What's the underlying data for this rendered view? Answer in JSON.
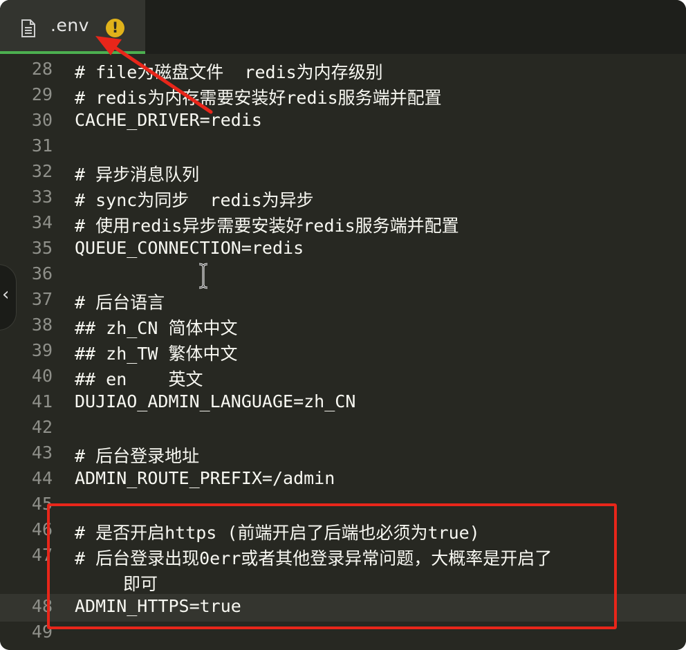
{
  "tab": {
    "title": ".env",
    "icon": "file-icon",
    "status_icon": "warning-icon",
    "warning_glyph": "!"
  },
  "editor": {
    "lines": [
      {
        "number": "28",
        "text": "# file为磁盘文件  redis为内存级别"
      },
      {
        "number": "29",
        "text": "# redis为内存需要安装好redis服务端并配置"
      },
      {
        "number": "30",
        "text": "CACHE_DRIVER=redis"
      },
      {
        "number": "31",
        "text": ""
      },
      {
        "number": "32",
        "text": "# 异步消息队列"
      },
      {
        "number": "33",
        "text": "# sync为同步  redis为异步"
      },
      {
        "number": "34",
        "text": "# 使用redis异步需要安装好redis服务端并配置"
      },
      {
        "number": "35",
        "text": "QUEUE_CONNECTION=redis"
      },
      {
        "number": "36",
        "text": ""
      },
      {
        "number": "37",
        "text": "# 后台语言"
      },
      {
        "number": "38",
        "text": "## zh_CN 简体中文"
      },
      {
        "number": "39",
        "text": "## zh_TW 繁体中文"
      },
      {
        "number": "40",
        "text": "## en    英文"
      },
      {
        "number": "41",
        "text": "DUJIAO_ADMIN_LANGUAGE=zh_CN"
      },
      {
        "number": "42",
        "text": ""
      },
      {
        "number": "43",
        "text": "# 后台登录地址"
      },
      {
        "number": "44",
        "text": "ADMIN_ROUTE_PREFIX=/admin"
      },
      {
        "number": "45",
        "text": ""
      },
      {
        "number": "46",
        "text": "# 是否开启https (前端开启了后端也必须为true)"
      },
      {
        "number": "47",
        "text": "# 后台登录出现0err或者其他登录异常问题，大概率是开启了"
      },
      {
        "number": "",
        "text": "即可"
      },
      {
        "number": "48",
        "text": "ADMIN_HTTPS=true"
      },
      {
        "number": "49",
        "text": ""
      }
    ]
  },
  "side_toggle": {
    "glyph": "‹",
    "icon": "chevron-left-icon"
  },
  "colors": {
    "editor_bg": "#272822",
    "tab_accent": "#4caf50",
    "warning": "#e0b21a",
    "annotation_red": "#e8261a"
  }
}
